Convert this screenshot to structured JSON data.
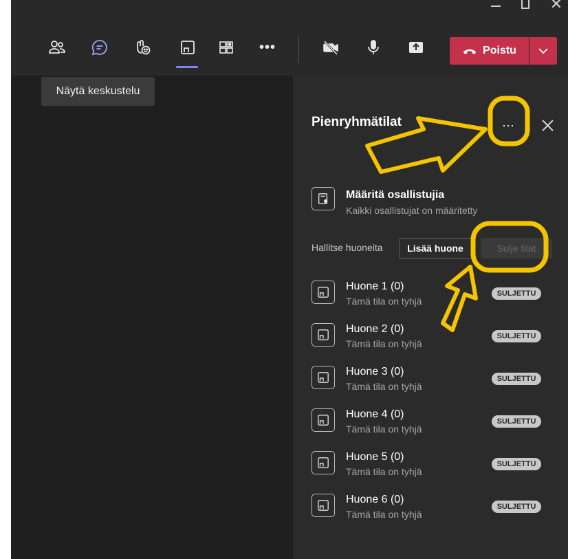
{
  "toolbar": {
    "icons": [
      "people-icon",
      "chat-icon",
      "reactions-icon",
      "breakout-rooms-icon",
      "apps-icon",
      "more-icon",
      "camera-off-icon",
      "microphone-icon",
      "share-icon"
    ],
    "leave_label": "Poistu"
  },
  "tooltip": {
    "text": "Näytä keskustelu"
  },
  "panel": {
    "title": "Pienryhmätilat",
    "more_label": "···",
    "assign": {
      "title": "Määritä osallistujia",
      "subtitle": "Kaikki osallistujat on määritetty"
    },
    "manage": {
      "label": "Hallitse huoneita",
      "add_room": "Lisää huone",
      "close_rooms": "Sulje tilat"
    },
    "rooms": [
      {
        "name": "Huone 1 (0)",
        "status": "Tämä tila on tyhjä",
        "badge": "SULJETTU"
      },
      {
        "name": "Huone 2 (0)",
        "status": "Tämä tila on tyhjä",
        "badge": "SULJETTU"
      },
      {
        "name": "Huone 3 (0)",
        "status": "Tämä tila on tyhjä",
        "badge": "SULJETTU"
      },
      {
        "name": "Huone 4 (0)",
        "status": "Tämä tila on tyhjä",
        "badge": "SULJETTU"
      },
      {
        "name": "Huone 5 (0)",
        "status": "Tämä tila on tyhjä",
        "badge": "SULJETTU"
      },
      {
        "name": "Huone 6 (0)",
        "status": "Tämä tila on tyhjä",
        "badge": "SULJETTU"
      }
    ]
  },
  "colors": {
    "leave_red": "#c4314b",
    "accent": "#7f85f5",
    "annotation_yellow": "#f5c400"
  }
}
